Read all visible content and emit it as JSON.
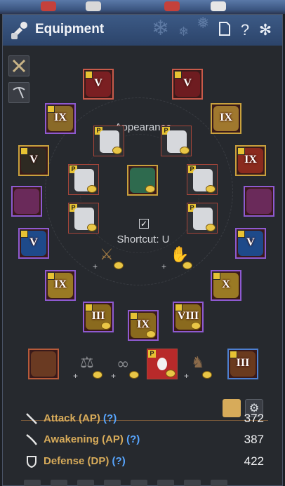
{
  "window": {
    "title": "Equipment",
    "title_icon": "wrench-icon",
    "buttons": {
      "copy": "copy-icon",
      "help": "?",
      "settings": "snowflake-settings-icon"
    }
  },
  "side_tabs": [
    "crossed-swords-icon",
    "pickaxe-icon"
  ],
  "appearance": {
    "label": "Appearance",
    "shortcut_label": "Shortcut: U",
    "shortcut_checked": true
  },
  "gear_grades": {
    "head_left": "V",
    "head_right": "V",
    "left_1": "IX",
    "right_1": "IX",
    "left_2": "V",
    "right_2": "IX",
    "left_4": "V",
    "right_4": "V",
    "left_5": "IX",
    "right_5": "X",
    "bottom_left": "III",
    "bottom_mid": "IX",
    "bottom_right": "VIII",
    "bottom_bar_right": "III"
  },
  "stats": [
    {
      "label": "Attack (AP)",
      "help": "(?)",
      "value": "372",
      "icon": "sword-icon"
    },
    {
      "label": "Awakening (AP)",
      "help": "(?)",
      "value": "387",
      "icon": "blade-icon"
    },
    {
      "label": "Defense (DP)",
      "help": "(?)",
      "value": "422",
      "icon": "shield-icon"
    }
  ],
  "colors": {
    "accent": "#d7ab5a",
    "help": "#58a6ff",
    "title_bar": "#2c446a"
  }
}
